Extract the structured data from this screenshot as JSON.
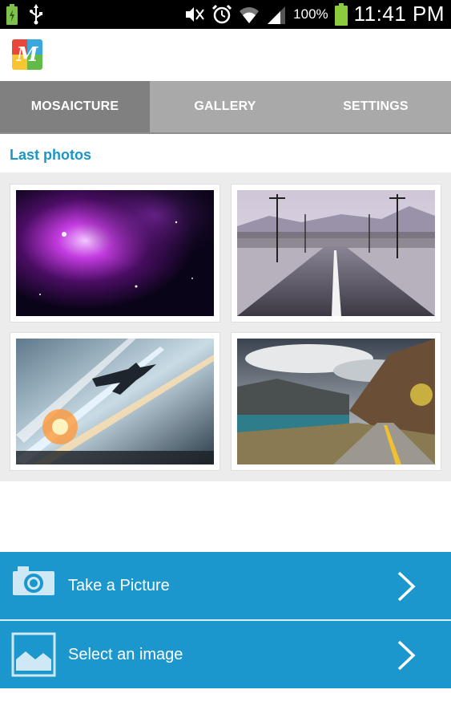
{
  "status_bar": {
    "battery_percent": "100%",
    "time": "11:41 PM",
    "icons": [
      "battery-charging-icon",
      "usb-icon",
      "mute-icon",
      "alarm-icon",
      "wifi-icon",
      "signal-icon",
      "battery-icon"
    ]
  },
  "app": {
    "logo_letter": "M",
    "logo_colors": [
      "#e8473c",
      "#f7c531",
      "#3aa8de",
      "#62bb46"
    ]
  },
  "tabs": [
    {
      "label": "MOSAICTURE",
      "active": true
    },
    {
      "label": "GALLERY",
      "active": false
    },
    {
      "label": "SETTINGS",
      "active": false
    }
  ],
  "section": {
    "title": "Last photos"
  },
  "photos": [
    {
      "subject": "nebula",
      "icon": "nebula-photo"
    },
    {
      "subject": "misty road with power poles",
      "icon": "road-photo"
    },
    {
      "subject": "fighter jets battle",
      "icon": "jet-photo"
    },
    {
      "subject": "mountain road by lake",
      "icon": "mountain-road-photo"
    }
  ],
  "actions": {
    "take_picture": "Take a Picture",
    "select_image": "Select an image"
  },
  "colors": {
    "accent": "#1b97cd",
    "section_title": "#1a96c8",
    "tab_bg": "#a9a9a9",
    "tab_active_bg": "#808080"
  }
}
